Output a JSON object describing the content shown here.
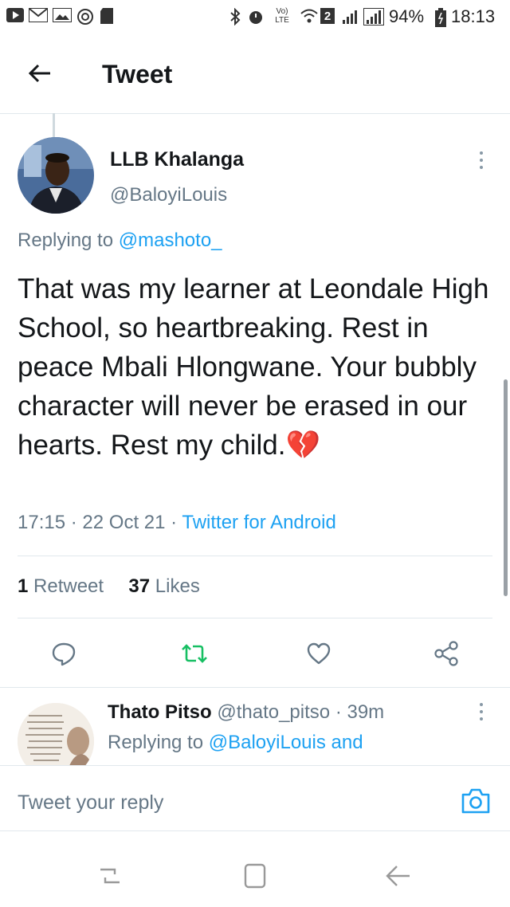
{
  "status_bar": {
    "network_label": "Vo) LTE",
    "sim_badge": "2",
    "battery": "94%",
    "time": "18:13"
  },
  "header": {
    "title": "Tweet",
    "back_icon": "arrow-left-icon"
  },
  "tweet": {
    "author_name": "LLB Khalanga",
    "author_handle": "@BaloyiLouis",
    "replying_prefix": "Replying to",
    "replying_to": "@mashoto_",
    "text": "That was my learner at Leondale High School,  so heartbreaking. Rest in peace Mbali Hlongwane. Your bubbly character will never be erased in our hearts. Rest my child.",
    "emoji": "💔",
    "time": "17:15",
    "date": "22 Oct 21",
    "source": "Twitter for Android",
    "retweet_count": "1",
    "retweet_label": "Retweet",
    "like_count": "37",
    "like_label": "Likes"
  },
  "actions": {
    "reply_icon": "reply-icon",
    "retweet_icon": "retweet-icon",
    "like_icon": "heart-icon",
    "share_icon": "share-icon",
    "retweet_color": "#17bf63"
  },
  "reply": {
    "author_name": "Thato Pitso",
    "author_handle": "@thato_pitso",
    "time_ago": "39m",
    "replying_prefix": "Replying to",
    "replying_to": "@BaloyiLouis and"
  },
  "compose": {
    "placeholder": "Tweet your reply",
    "camera_icon": "camera-icon"
  },
  "colors": {
    "link": "#1da1f2",
    "secondary_text": "#657786",
    "primary_text": "#14171a"
  }
}
